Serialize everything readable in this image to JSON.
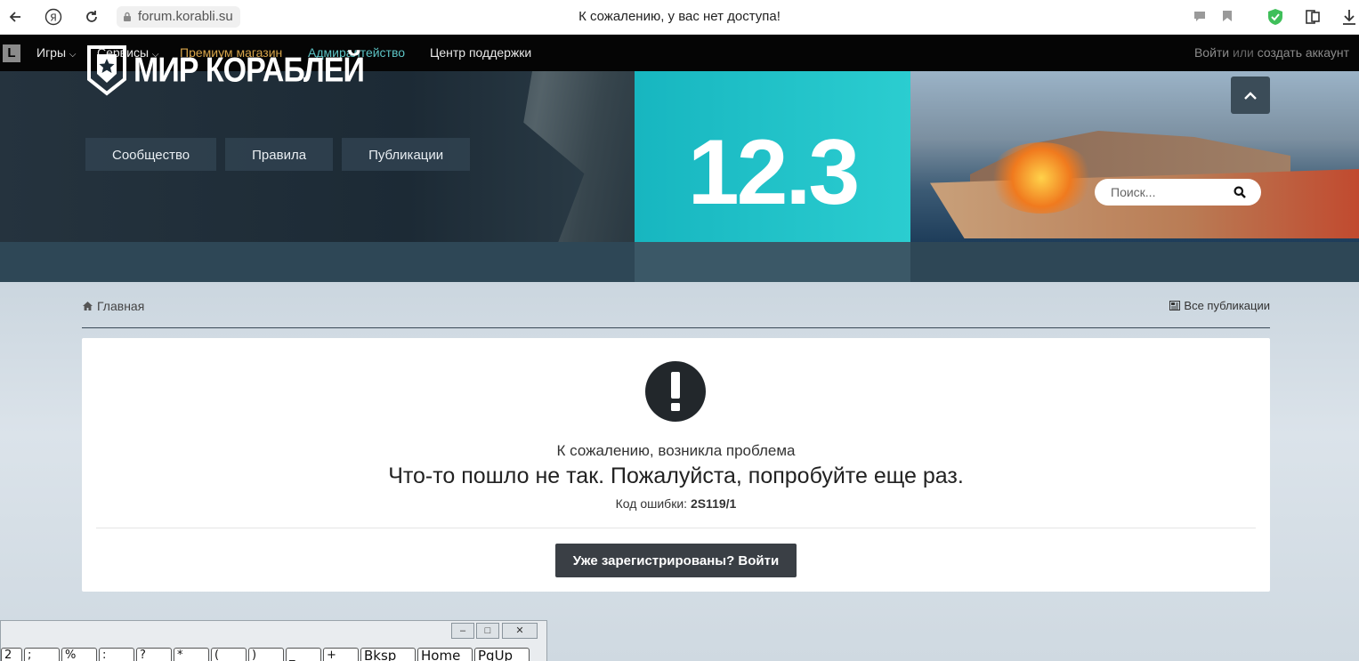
{
  "browser": {
    "url": "forum.korabli.su",
    "tab_title": "К сожалению, у вас нет доступа!"
  },
  "topnav": {
    "logo": "L",
    "items": [
      "Игры",
      "Сервисы",
      "Премиум магазин",
      "Адмиралтейство",
      "Центр поддержки"
    ],
    "auth_login": "Войти",
    "auth_or": "или",
    "auth_register": "создать аккаунт"
  },
  "header": {
    "brand": "МИР КОРАБЛЕЙ",
    "version": "12.3",
    "tabs": [
      "Сообщество",
      "Правила",
      "Публикации"
    ],
    "search_placeholder": "Поиск..."
  },
  "breadcrumb": {
    "home": "Главная",
    "all_publications": "Все публикации"
  },
  "error": {
    "title": "К сожалению, возникла проблема",
    "message": "Что-то пошло не так. Пожалуйста, попробуйте еще раз.",
    "code_label": "Код ошибки:",
    "code": "2S119/1",
    "login_button": "Уже зарегистрированы? Войти"
  },
  "osk": {
    "keys": [
      "2",
      ";",
      "%",
      ":",
      "?",
      "*",
      "(",
      ")",
      "_",
      "+",
      "Bksp",
      "Home",
      "PgUp"
    ]
  },
  "colors": {
    "accent_gold": "#d6a44a",
    "accent_teal": "#5cc3c4",
    "version_panel": "#17b6c0",
    "button": "#3a3f45"
  }
}
